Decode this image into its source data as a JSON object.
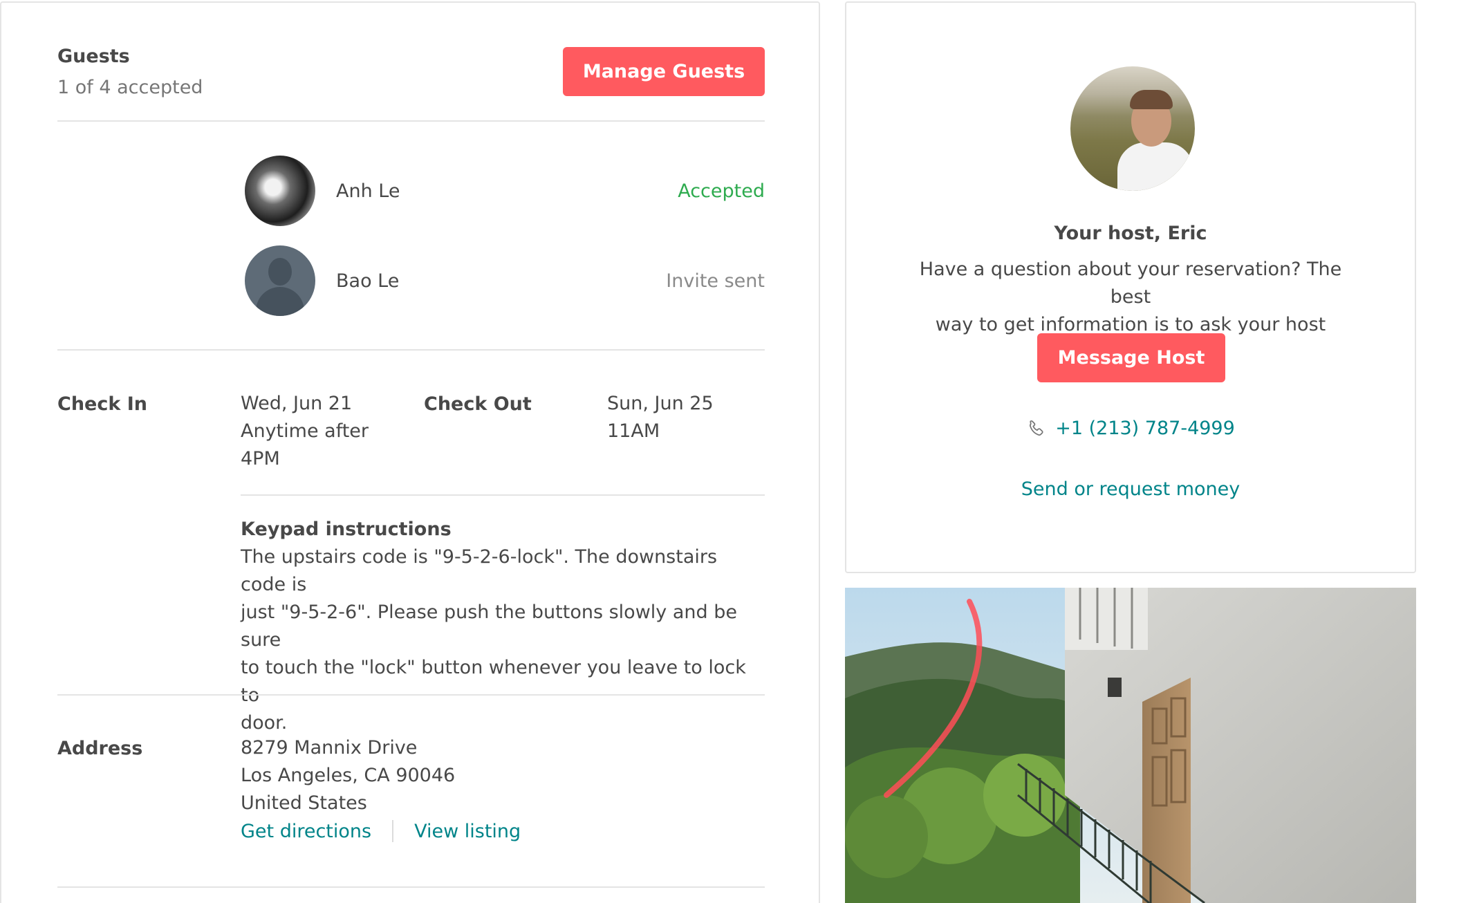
{
  "guests": {
    "title": "Guests",
    "subtitle": "1 of 4 accepted",
    "manage_button": "Manage Guests",
    "list": [
      {
        "name": "Anh Le",
        "status": "Accepted"
      },
      {
        "name": "Bao Le",
        "status": "Invite sent"
      }
    ]
  },
  "checkin": {
    "label": "Check In",
    "date": "Wed, Jun 21",
    "time_line1": "Anytime after",
    "time_line2": "4PM"
  },
  "checkout": {
    "label": "Check Out",
    "date": "Sun, Jun 25",
    "time": "11AM"
  },
  "keypad": {
    "title": "Keypad instructions",
    "line1": "The upstairs code is \"9-5-2-6-lock\". The downstairs code is",
    "line2": "just \"9-5-2-6\". Please push the buttons slowly and be sure",
    "line3": "to touch the \"lock\" button whenever you leave to lock to",
    "line4": "door."
  },
  "address": {
    "label": "Address",
    "line1": "8279 Mannix Drive",
    "line2": "Los Angeles, CA 90046",
    "line3": "United States",
    "get_directions": "Get directions",
    "view_listing": "View listing"
  },
  "host": {
    "title": "Your host, Eric",
    "desc_line1": "Have a question about your reservation? The best",
    "desc_line2": "way to get information is to ask your host directly.",
    "message_button": "Message Host",
    "phone": "+1 (213) 787-4999",
    "send_money": "Send or request money",
    "phone_icon": "phone-icon"
  },
  "colors": {
    "brand": "#ff5a5f",
    "link": "#008489",
    "accepted": "#2eab4f"
  }
}
